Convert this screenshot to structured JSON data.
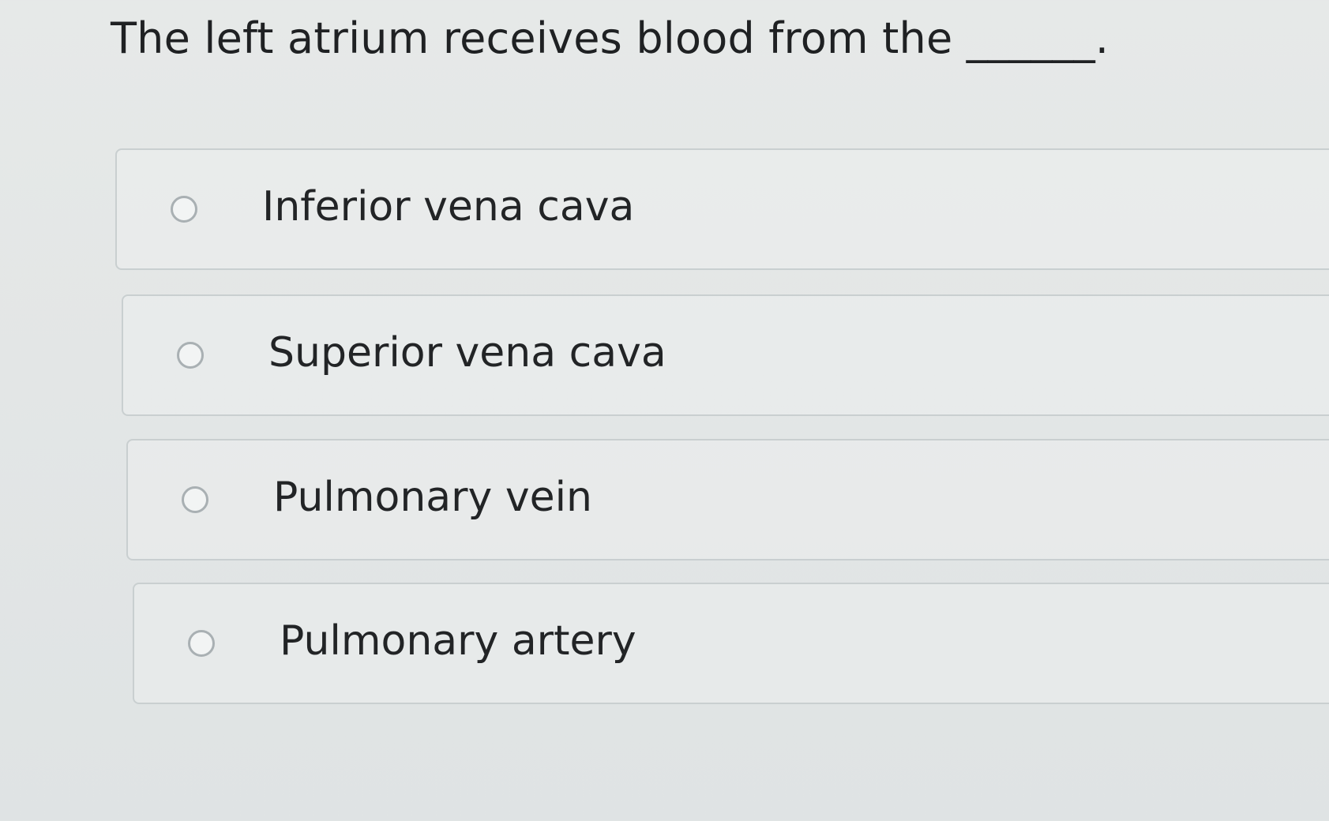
{
  "question": {
    "text": "The left atrium receives blood from the ______."
  },
  "options": [
    {
      "label": "Inferior vena cava",
      "selected": false
    },
    {
      "label": "Superior vena cava",
      "selected": false
    },
    {
      "label": "Pulmonary vein",
      "selected": false
    },
    {
      "label": "Pulmonary artery",
      "selected": false
    }
  ]
}
